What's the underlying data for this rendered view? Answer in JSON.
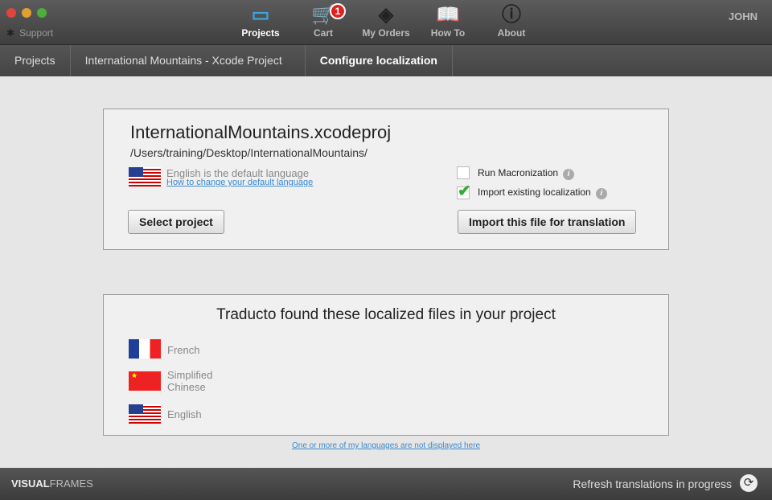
{
  "toolbar": {
    "support": "Support",
    "user": "JOHN",
    "items": [
      {
        "label": "Projects"
      },
      {
        "label": "Cart",
        "badge": "1"
      },
      {
        "label": "My Orders"
      },
      {
        "label": "How To"
      },
      {
        "label": "About"
      }
    ]
  },
  "breadcrumb": [
    "Projects",
    "International Mountains - Xcode Project",
    "Configure localization"
  ],
  "project": {
    "name": "InternationalMountains.xcodeproj",
    "path": "/Users/training/Desktop/InternationalMountains/",
    "default_language": "English is the default language",
    "change_link": "How to change your default language",
    "select_button": "Select project",
    "run_macronization": "Run Macronization",
    "import_existing": "Import existing localization",
    "import_button": "Import this file for translation"
  },
  "found": {
    "title": "Traducto found these localized files in your project",
    "languages": [
      "French",
      "Simplified Chinese",
      "English"
    ],
    "missing_link": "One or more of my languages are not displayed here"
  },
  "footer": {
    "brand_bold": "VISUAL",
    "brand_light": "FRAMES",
    "status": "Refresh translations in progress"
  }
}
